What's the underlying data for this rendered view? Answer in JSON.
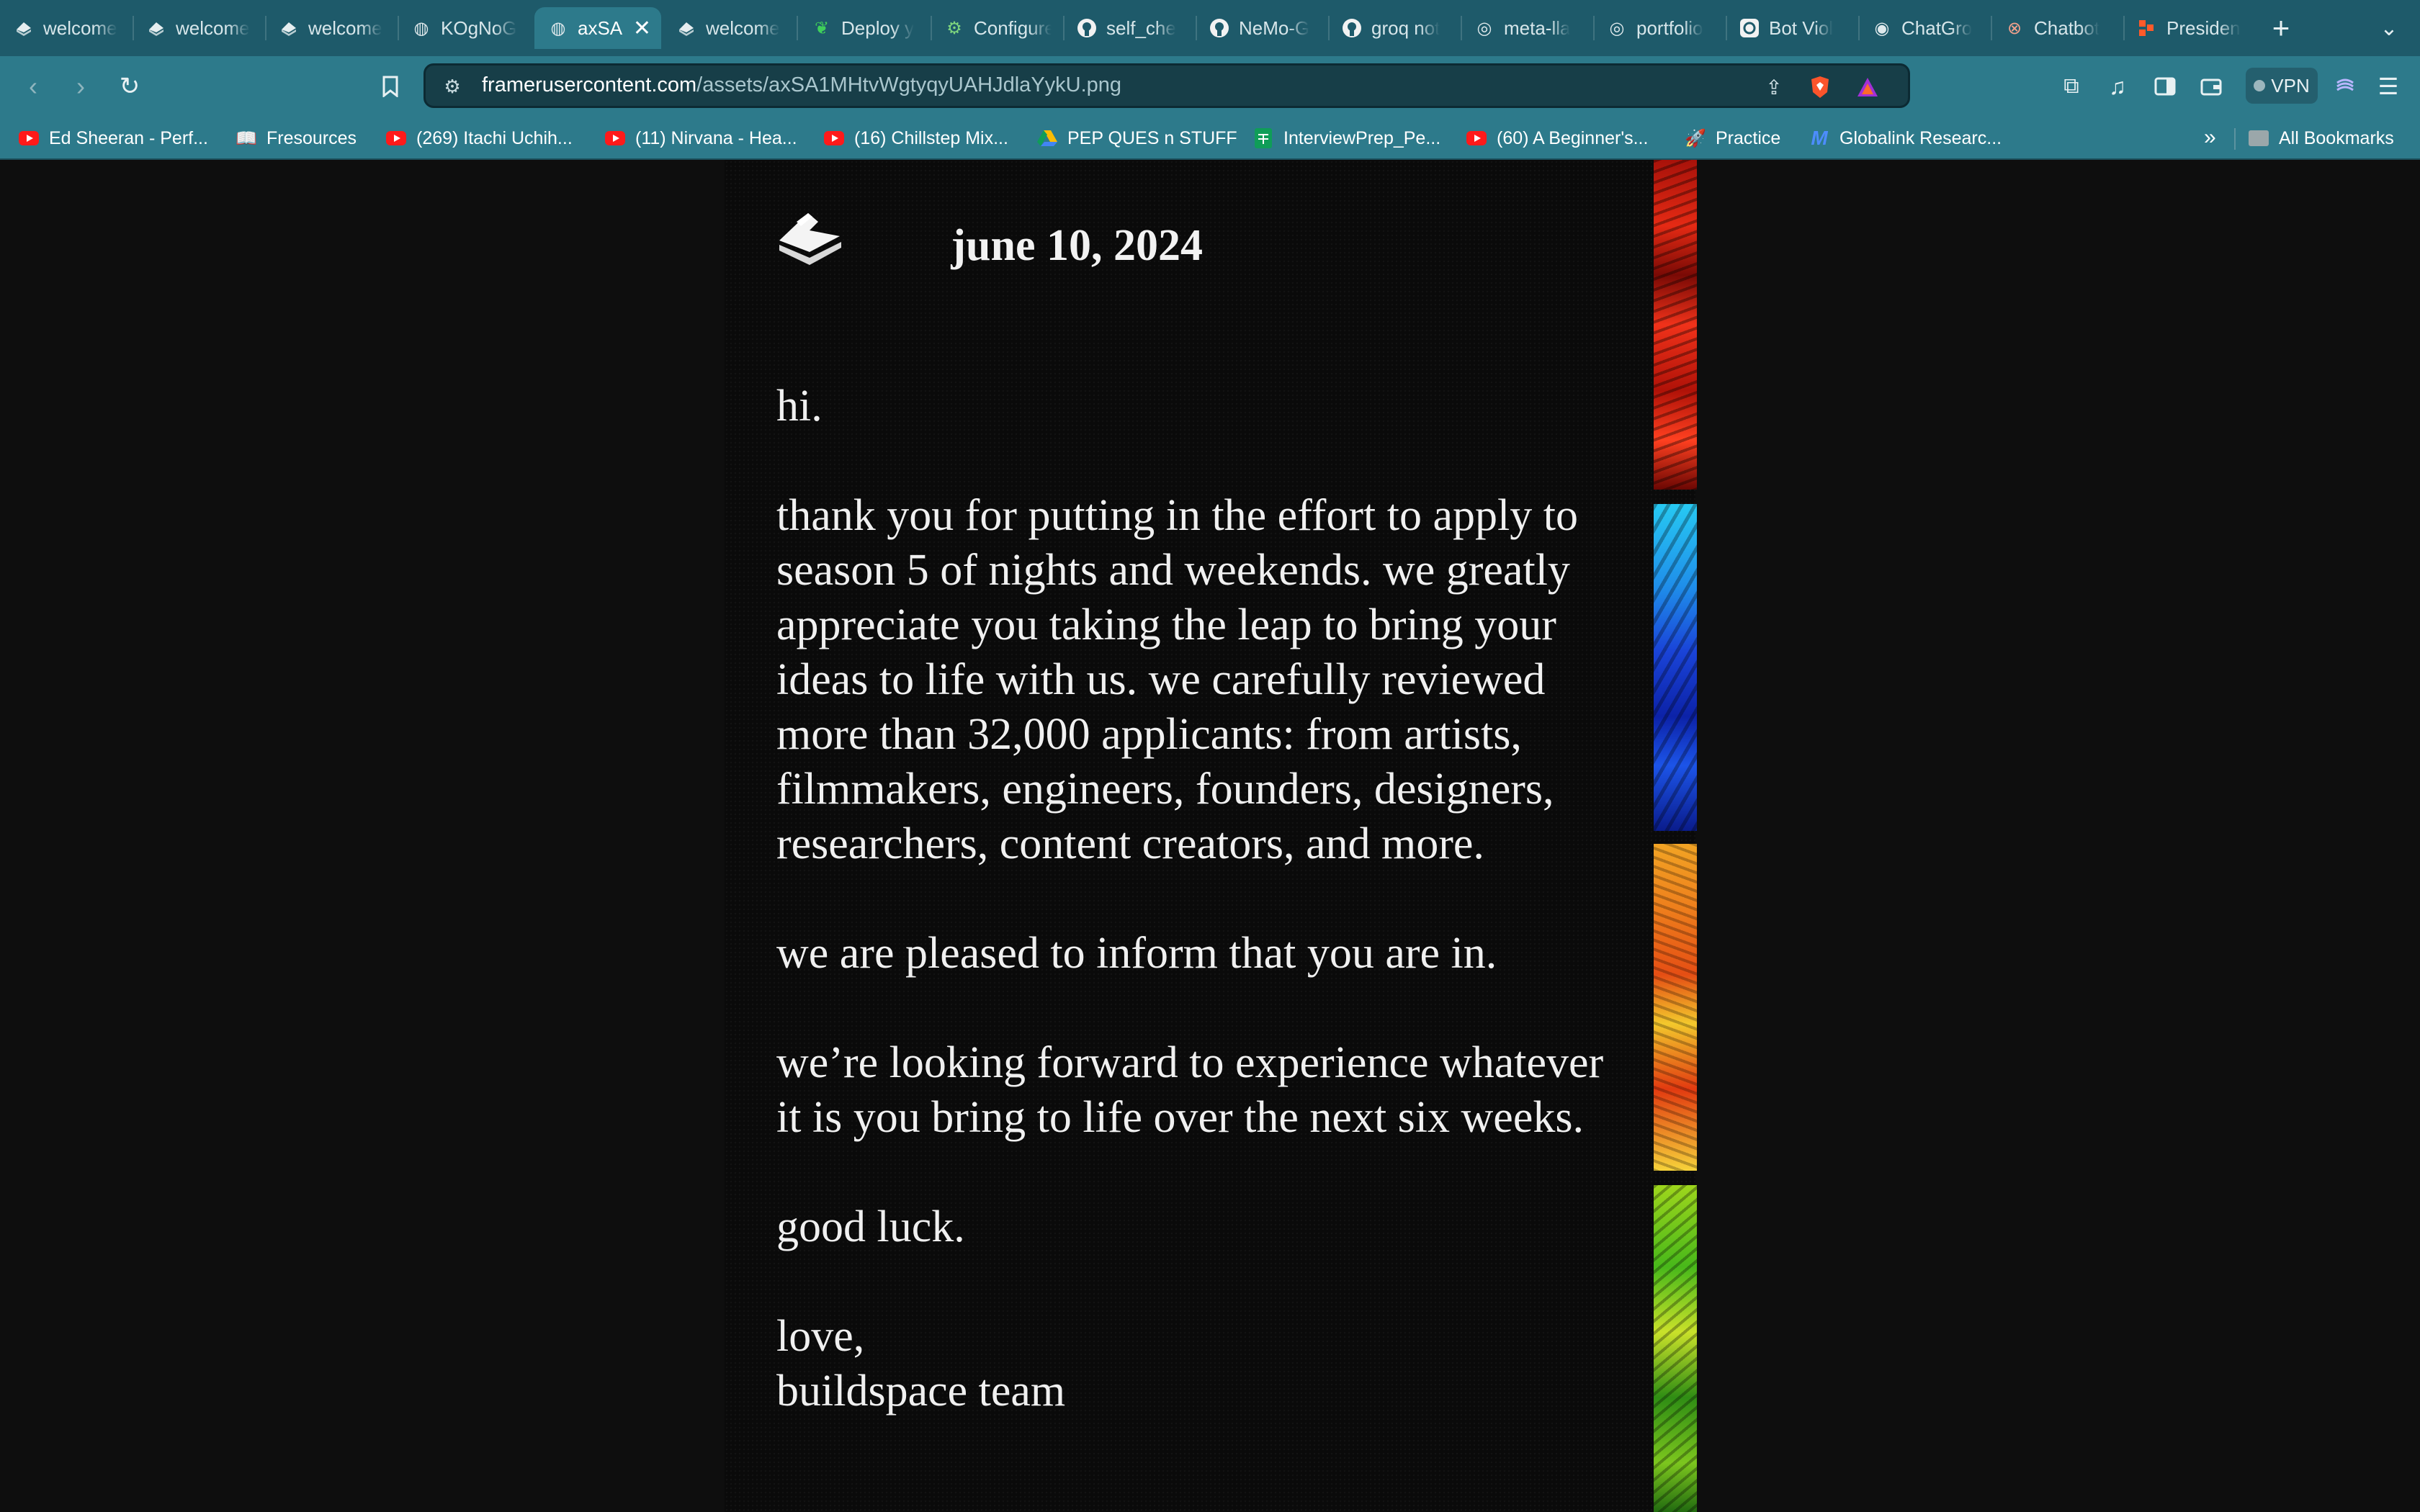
{
  "tabs": [
    {
      "title": "welcome",
      "icon": "buildspace-icon",
      "active": false
    },
    {
      "title": "welcome",
      "icon": "buildspace-icon",
      "active": false
    },
    {
      "title": "welcome",
      "icon": "buildspace-icon",
      "active": false
    },
    {
      "title": "KOgNoG",
      "icon": "globe-icon",
      "active": false
    },
    {
      "title": "axSA",
      "icon": "globe-icon",
      "active": true
    },
    {
      "title": "welcome",
      "icon": "buildspace-icon",
      "active": false
    },
    {
      "title": "Deploy y",
      "icon": "leaf-icon",
      "active": false
    },
    {
      "title": "Configure",
      "icon": "gear-icon",
      "active": false
    },
    {
      "title": "self_che",
      "icon": "github-icon",
      "active": false
    },
    {
      "title": "NeMo-G",
      "icon": "github-icon",
      "active": false
    },
    {
      "title": "groq not",
      "icon": "github-icon",
      "active": false
    },
    {
      "title": "meta-lla",
      "icon": "replicate-icon",
      "active": false
    },
    {
      "title": "portfolio",
      "icon": "replicate-icon",
      "active": false
    },
    {
      "title": "Bot Viol",
      "icon": "openai-icon",
      "active": false
    },
    {
      "title": "ChatGro",
      "icon": "chat-icon",
      "active": false
    },
    {
      "title": "Chatbot",
      "icon": "chatbot-icon",
      "active": false
    },
    {
      "title": "Presiden",
      "icon": "presidio-icon",
      "active": false
    }
  ],
  "address_bar": {
    "domain": "framerusercontent.com",
    "path": "/assets/axSA1MHtvWgtyqyUAHJdlaYykU.png"
  },
  "vpn_label": "VPN",
  "bookmarks": [
    {
      "label": "Ed Sheeran - Perf...",
      "icon": "youtube-icon"
    },
    {
      "label": "Fresources",
      "icon": "book-icon"
    },
    {
      "label": "(269) Itachi Uchih...",
      "icon": "youtube-icon"
    },
    {
      "label": "(11) Nirvana - Hea...",
      "icon": "youtube-icon"
    },
    {
      "label": "(16) Chillstep Mix...",
      "icon": "youtube-icon"
    },
    {
      "label": "PEP QUES n STUFF",
      "icon": "google-drive-icon"
    },
    {
      "label": "InterviewPrep_Pe...",
      "icon": "sheets-icon"
    },
    {
      "label": "(60) A Beginner's...",
      "icon": "youtube-icon"
    },
    {
      "label": "Practice",
      "icon": "rocket-icon"
    },
    {
      "label": "Globalink Researc...",
      "icon": "mitacs-icon"
    }
  ],
  "all_bookmarks_label": "All Bookmarks",
  "letter": {
    "date": "june 10, 2024",
    "greeting": "hi.",
    "paragraph1": "thank you for putting in the effort to apply to season 5 of nights and weekends. we greatly appreciate you taking the leap to bring your ideas to life with us. we carefully reviewed more than 32,000 applicants: from artists, filmmakers, engineers, founders, designers, researchers, content creators, and more.",
    "paragraph2": "we are pleased to inform that you are in.",
    "paragraph3": "we’re looking forward to experience whatever it is you bring to life over the next six weeks.",
    "paragraph4": "good luck.",
    "signoff_line1": "love,",
    "signoff_line2": "buildspace team"
  },
  "colors": {
    "tab_strip": "#1e5a6a",
    "toolbar": "#2d7a8b",
    "page_background": "#0e0e0e",
    "letter_text": "#f0f0f0"
  }
}
